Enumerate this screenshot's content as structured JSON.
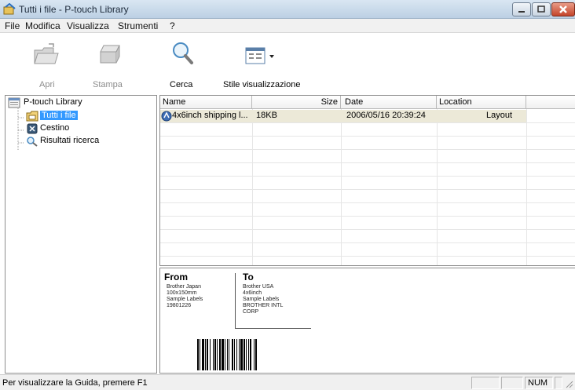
{
  "window": {
    "title": "Tutti i file - P-touch Library"
  },
  "menu": [
    "File",
    "Modifica",
    "Visualizza",
    "Strumenti",
    "?"
  ],
  "toolbar": {
    "open": "Apri",
    "print": "Stampa",
    "search": "Cerca",
    "view_style": "Stile visualizzazione"
  },
  "tree": {
    "root": "P-touch Library",
    "items": [
      "Tutti i file",
      "Cestino",
      "Risultati ricerca"
    ]
  },
  "list": {
    "columns": [
      "Name",
      "Size",
      "Date",
      "Location"
    ],
    "rows": [
      {
        "name": "4x6inch shipping l...",
        "size": "18KB",
        "date": "2006/05/16 20:39:24",
        "location": "Layout"
      }
    ]
  },
  "preview": {
    "from_heading": "From",
    "to_heading": "To",
    "from_lines": [
      "Brother Japan",
      "100x150mm",
      "Sample Labels",
      "19801226"
    ],
    "to_lines": [
      "Brother USA",
      "4x6inch",
      "Sample Labels",
      "BROTHER INTL",
      "CORP"
    ]
  },
  "status": {
    "help_text": "Per visualizzare la Guida, premere F1",
    "num": "NUM"
  },
  "colors": {
    "selection": "#3399ff",
    "row_highlight": "#ece9d8"
  }
}
